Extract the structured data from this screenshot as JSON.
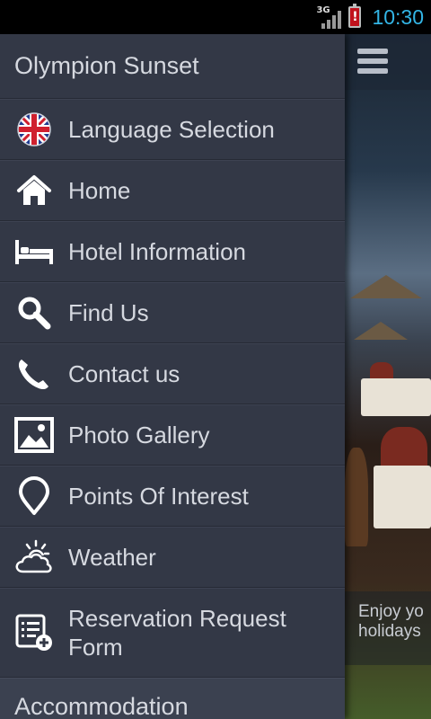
{
  "status_bar": {
    "network": "3G",
    "battery_alert": "!",
    "time": "10:30"
  },
  "drawer": {
    "title": "Olympion Sunset",
    "items": [
      {
        "label": "Language Selection",
        "icon": "uk-flag-icon"
      },
      {
        "label": "Home",
        "icon": "home-icon"
      },
      {
        "label": "Hotel Information",
        "icon": "bed-icon"
      },
      {
        "label": "Find Us",
        "icon": "search-icon"
      },
      {
        "label": "Contact us",
        "icon": "phone-icon"
      },
      {
        "label": "Photo Gallery",
        "icon": "photo-icon"
      },
      {
        "label": "Points Of Interest",
        "icon": "map-pin-icon"
      },
      {
        "label": "Weather",
        "icon": "weather-icon"
      },
      {
        "label": "Reservation Request Form",
        "icon": "form-icon"
      }
    ],
    "section": "Accommodation"
  },
  "background": {
    "caption_line1": "Enjoy yo",
    "caption_line2": "holidays"
  },
  "colors": {
    "drawer_bg": "#333846",
    "text": "#d6d9e0",
    "clock": "#33b5e5"
  }
}
